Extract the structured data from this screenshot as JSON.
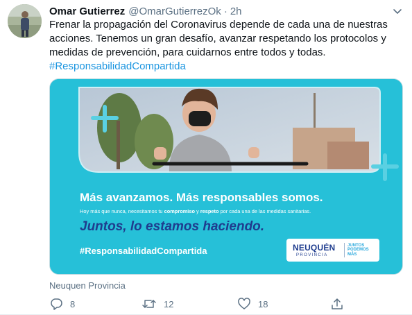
{
  "tweet": {
    "author_name": "Omar Gutierrez",
    "handle": "@OmarGutierrezOk",
    "separator": "·",
    "time": "2h",
    "text_lines": [
      "Frenar la propagación del Coronavirus depende de cada una de nuestras",
      "acciones. Tenemos un gran desafío, avanzar respetando los protocolos y",
      "medidas de prevención, para cuidarnos entre todos y todas."
    ],
    "hashtag": "#ResponsabilidadCompartida",
    "source_label": "Neuquen Provincia"
  },
  "card": {
    "headline": "Más avanzamos. Más responsables somos.",
    "subline_parts": [
      "Hoy más que nunca, necesitamos tu ",
      "compromiso",
      " y ",
      "respeto",
      " por cada una de las medidas sanitarias."
    ],
    "tagline": "Juntos, lo estamos haciendo.",
    "hashtag": "#ResponsabilidadCompartida",
    "logo_main": "NEUQUÉN",
    "logo_sub": "PROVINCIA",
    "logo_slogan": "JUNTOS PODEMOS MÁS"
  },
  "actions": {
    "reply_count": "8",
    "retweet_count": "12",
    "like_count": "18"
  },
  "icons": {
    "caret": "chevron-down-icon",
    "reply": "reply-icon",
    "retweet": "retweet-icon",
    "like": "heart-icon",
    "share": "share-icon"
  },
  "colors": {
    "link": "#1b95e0",
    "card_bg": "#26c0d8",
    "tagline": "#1f3c8e",
    "muted": "#5b7083"
  }
}
